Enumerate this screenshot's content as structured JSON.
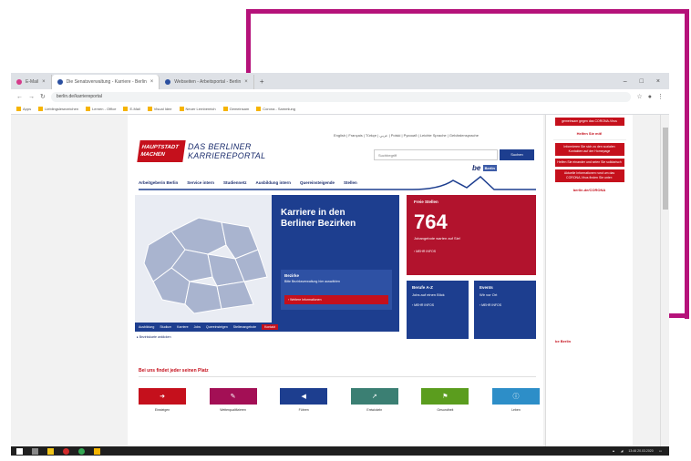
{
  "browser": {
    "tabs": [
      {
        "label": "E-Mail",
        "active": false
      },
      {
        "label": "Die Senatsverwaltung - Karriere - Berlin",
        "active": true
      },
      {
        "label": "Webseiten - Arbeitsportal - Berlin",
        "active": false
      }
    ],
    "url": "berlin.de/karriereportal",
    "bookmarks": [
      "Apps",
      "Lieblingslesezeichen",
      "Lernen - Office",
      "E-Mail",
      "Visual Idee",
      "Neuer Lernbereich",
      "Gemeinsam",
      "Corona - Sammlung"
    ]
  },
  "header": {
    "logo_line1": "HAUPTSTADT",
    "logo_line2": "MACHEN",
    "logo_text_line1": "DAS BERLINER",
    "logo_text_line2": "KARRIEREPORTAL",
    "toplinks": "English | Français | Türkçe | عربي | Polski | Русский | Leichte Sprache | Gebärdensprache",
    "search_placeholder": "Suchbegriff",
    "search_button": "Suchen",
    "nav": [
      "Arbeitgeberin Berlin",
      "Service intern",
      "Studiennetz",
      "Ausbildung intern",
      "Quereinsteigende",
      "Stellen"
    ],
    "berlin_logo": "be",
    "berlin_logo_box": "Berlin"
  },
  "hero": {
    "title_line1": "Karriere in den",
    "title_line2": "Berliner Bezirken",
    "box_title": "Bezirke",
    "box_text": "Bitte Bezirksverwaltung hier auswählen",
    "box_button": "Weitere Informationen",
    "tabs": [
      "Ausbildung",
      "Studium",
      "Karriere",
      "Jobs",
      "Quereinsteigen",
      "Stellenangebote",
      "Kontakt"
    ],
    "foot": "Bezirkskarte anklicken"
  },
  "cards": {
    "free_label": "Freie Stellen",
    "free_number": "764",
    "free_sub": "Jobangebote warten auf Sie!",
    "free_more": "MEHR INFOS",
    "berufe_label": "Berufe A-Z",
    "berufe_text": "Jobs auf einen Blick",
    "berufe_more": "MEHR INFOS",
    "events_label": "Events",
    "events_text": "Wir vor Ort",
    "events_more": "MEHR INFOS"
  },
  "services": {
    "title": "Bei uns findet jeder seinen Platz",
    "items": [
      {
        "label": "Einsteigen",
        "color": "#c5101c",
        "icon": "arrow-icon"
      },
      {
        "label": "Weiterqualifizieren",
        "color": "#a30f55",
        "icon": "edit-icon"
      },
      {
        "label": "Führen",
        "color": "#1d3e8f",
        "icon": "megaphone-icon"
      },
      {
        "label": "Entwickeln",
        "color": "#3b7f73",
        "icon": "chart-icon"
      },
      {
        "label": "Gesundheit",
        "color": "#5b9d1e",
        "icon": "flag-icon"
      },
      {
        "label": "Leben",
        "color": "#2d8ec8",
        "icon": "info-icon"
      }
    ]
  },
  "corona": {
    "items": [
      "gemeinsam gegen das CORONA-Virus",
      "Helfen Sie mit!",
      "Informieren Sie sich zu den sozialen Kontakten auf der Homepage",
      "Helfen Sie einander und seien Sie solidarisch",
      "Aktuelle Informationen rund um das CORONA-Virus finden Sie unter:"
    ],
    "link": "berlin.de/CORONA",
    "foot": "be Berlin"
  },
  "taskbar": {
    "time": "13:46",
    "date": "20.03.2020"
  }
}
